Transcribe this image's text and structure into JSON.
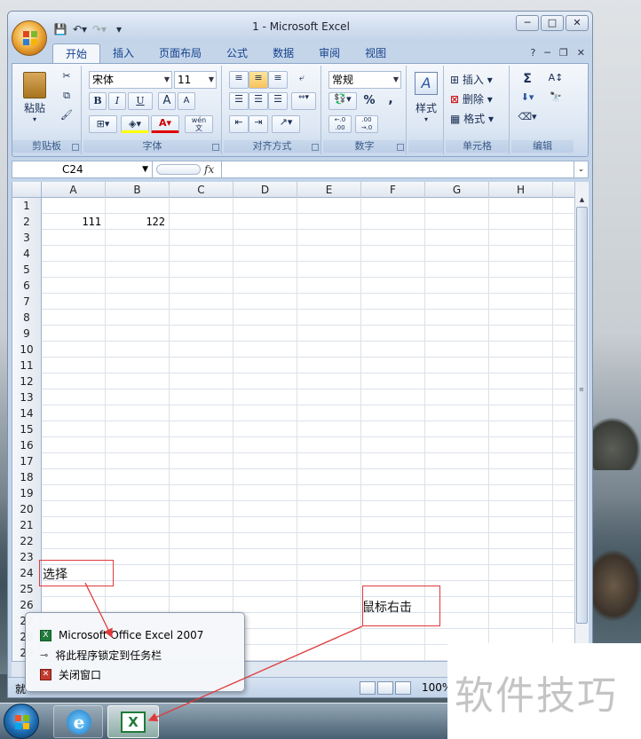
{
  "window": {
    "title": "1 - Microsoft Excel",
    "controls": [
      "─",
      "□",
      "✕"
    ]
  },
  "ribbon_tabs": [
    "开始",
    "插入",
    "页面布局",
    "公式",
    "数据",
    "审阅",
    "视图"
  ],
  "ribbon": {
    "clipboard": {
      "paste": "粘贴",
      "label": "剪贴板"
    },
    "font": {
      "name": "宋体",
      "size": "11",
      "label": "字体",
      "bold": "B",
      "italic": "I",
      "underline": "U",
      "grow": "A",
      "shrink": "A",
      "wen": "wén\n文"
    },
    "alignment": {
      "label": "对齐方式"
    },
    "number": {
      "format": "常规",
      "percent": "%",
      "comma": ",",
      "inc": "←.0\n.00",
      "dec": ".00\n→.0",
      "label": "数字"
    },
    "styles": {
      "label": "样式"
    },
    "cells": {
      "insert": "插入",
      "delete": "删除",
      "format": "格式",
      "label": "单元格"
    },
    "editing": {
      "sigma": "Σ",
      "label": "编辑"
    }
  },
  "formula_bar": {
    "name_box": "C24",
    "fx": "fx",
    "value": ""
  },
  "columns": [
    "A",
    "B",
    "C",
    "D",
    "E",
    "F",
    "G",
    "H"
  ],
  "rows": [
    {
      "n": "1",
      "A": "",
      "B": ""
    },
    {
      "n": "2",
      "A": "111",
      "B": "122"
    },
    {
      "n": "3"
    },
    {
      "n": "4"
    },
    {
      "n": "5"
    },
    {
      "n": "6"
    },
    {
      "n": "7"
    },
    {
      "n": "8"
    },
    {
      "n": "9"
    },
    {
      "n": "10"
    },
    {
      "n": "11"
    },
    {
      "n": "12"
    },
    {
      "n": "13"
    },
    {
      "n": "14"
    },
    {
      "n": "15"
    },
    {
      "n": "16"
    },
    {
      "n": "17"
    },
    {
      "n": "18"
    },
    {
      "n": "19"
    },
    {
      "n": "20"
    },
    {
      "n": "21"
    },
    {
      "n": "22"
    },
    {
      "n": "23"
    },
    {
      "n": "24"
    },
    {
      "n": "25"
    },
    {
      "n": "26"
    },
    {
      "n": "27"
    },
    {
      "n": "28"
    },
    {
      "n": "29"
    }
  ],
  "status": {
    "left": "就",
    "zoom": "100%"
  },
  "jumplist": [
    {
      "label": "Microsoft Office Excel 2007",
      "icon": "excel-icon"
    },
    {
      "label": "将此程序锁定到任务栏",
      "icon": "pin-icon"
    },
    {
      "label": "关闭窗口",
      "icon": "close-window-icon"
    }
  ],
  "annotations": {
    "select": "选择",
    "right_click": "鼠标右击",
    "color": "#e03a3a"
  },
  "watermark": "软件技巧"
}
